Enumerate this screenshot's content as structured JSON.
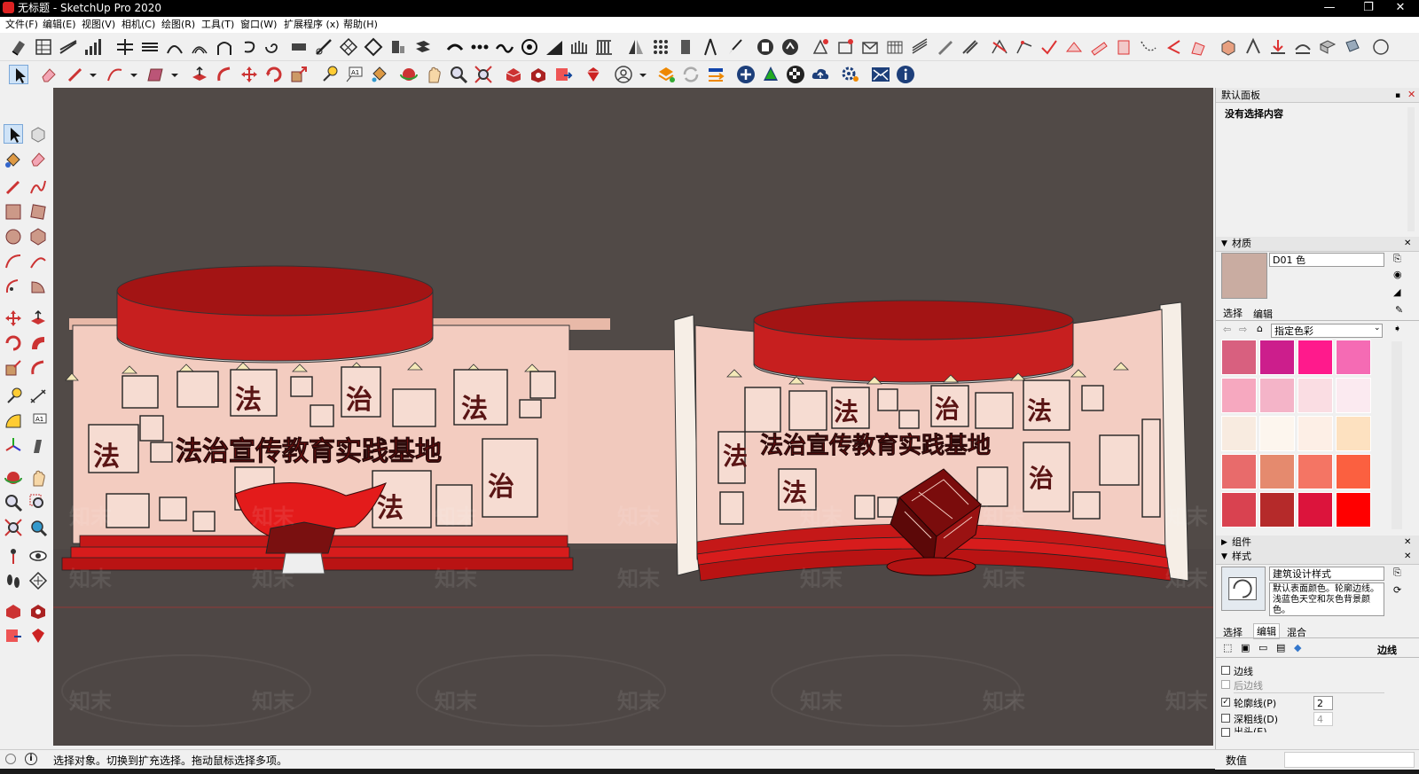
{
  "window": {
    "title": "无标题 - SketchUp Pro 2020",
    "min": "—",
    "restore": "❐",
    "close": "✕"
  },
  "menu": [
    "文件(F)",
    "编辑(E)",
    "视图(V)",
    "相机(C)",
    "绘图(R)",
    "工具(T)",
    "窗口(W)",
    "扩展程序 (x)",
    "帮助(H)"
  ],
  "status": {
    "text": "选择对象。切换到扩充选择。拖动鼠标选择多项。",
    "value_label": "数值"
  },
  "scene": {
    "left_banner": "法治宣传教育实践基地",
    "right_banner": "法治宣传教育实践基地",
    "watermarks": [
      "知末",
      "知末",
      "知末",
      "知末",
      "知末",
      "知末",
      "知末",
      "知末",
      "知末",
      "知末",
      "知末",
      "知末",
      "知末",
      "知末",
      "知末",
      "知末",
      "知末",
      "知末",
      "知末",
      "知末",
      "知末"
    ],
    "stamp_chars": [
      "法",
      "法",
      "治",
      "法",
      "法",
      "治",
      "法",
      "法",
      "治",
      "法",
      "治",
      "法"
    ]
  },
  "tray": {
    "title": "默认面板",
    "selection": "没有选择内容",
    "materials": {
      "header": "材质",
      "name": "D01 色",
      "tab_select": "选择",
      "tab_edit": "编辑",
      "collection": "指定色彩",
      "current_color": "#c9aca1",
      "swatches": [
        "#d8607f",
        "#cc1e8c",
        "#ff1a8c",
        "#f56bb4",
        "#f6a8bf",
        "#f4b4c8",
        "#fadde3",
        "#fbeaf0",
        "#f8ebe0",
        "#fdf6ee",
        "#fdefe6",
        "#fde1c0",
        "#e86b6b",
        "#e58a6e",
        "#f47564",
        "#fb6040",
        "#d94250",
        "#b52a2a",
        "#dc143c",
        "#ff0000"
      ]
    },
    "components": {
      "header": "组件"
    },
    "styles": {
      "header": "样式",
      "name": "建筑设计样式",
      "description": "默认表面颜色。轮廓边线。浅蓝色天空和灰色背景颜色。",
      "tab_select": "选择",
      "tab_edit": "编辑",
      "tab_mix": "混合",
      "section": "边线",
      "edges": "边线",
      "back_edges": "后边线",
      "profiles": "轮廓线(P)",
      "profiles_value": "2",
      "depth_cue": "深粗线(D)",
      "depth_cue_value": "4",
      "extension": "出头(E)"
    }
  }
}
